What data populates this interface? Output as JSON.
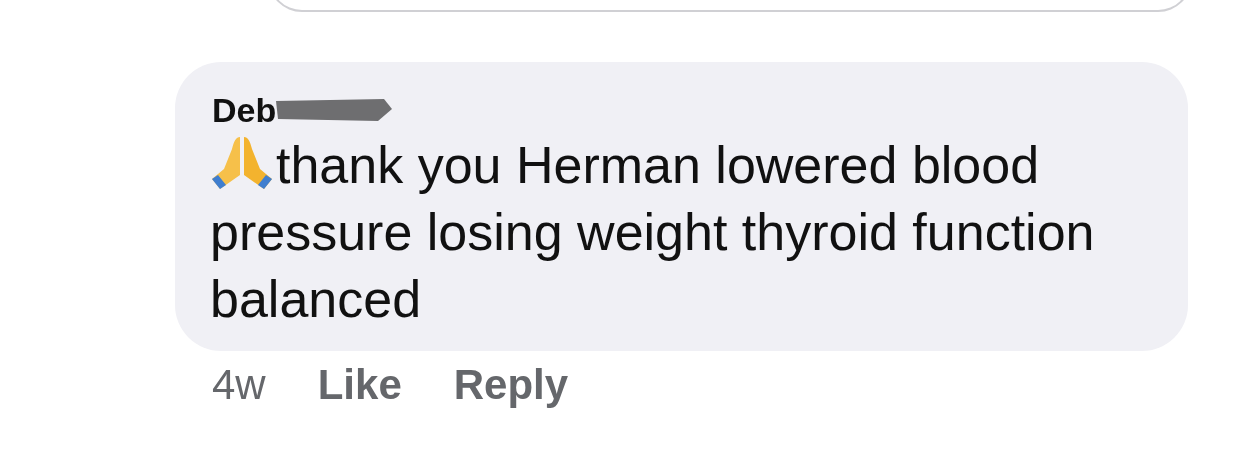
{
  "comment": {
    "author": "Deb",
    "author_redacted": true,
    "text": "thank you Herman lowered blood pressure losing weight thyroid function balanced",
    "time": "4w",
    "actions": [
      "Like",
      "Reply"
    ]
  }
}
